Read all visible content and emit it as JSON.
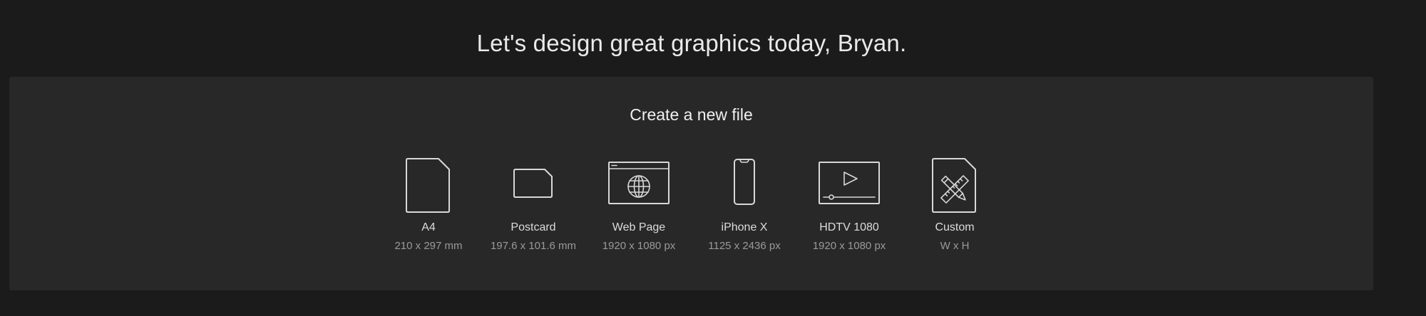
{
  "greeting": "Let's design great graphics today, Bryan.",
  "panel": {
    "title": "Create a new file",
    "presets": [
      {
        "name": "A4",
        "dims": "210 x 297 mm",
        "icon": "document-icon"
      },
      {
        "name": "Postcard",
        "dims": "197.6 x 101.6 mm",
        "icon": "postcard-icon"
      },
      {
        "name": "Web Page",
        "dims": "1920 x 1080 px",
        "icon": "web-page-icon"
      },
      {
        "name": "iPhone X",
        "dims": "1125 x 2436 px",
        "icon": "phone-icon"
      },
      {
        "name": "HDTV 1080",
        "dims": "1920 x 1080 px",
        "icon": "video-screen-icon"
      },
      {
        "name": "Custom",
        "dims": "W x H",
        "icon": "custom-ruler-pencil-icon"
      }
    ]
  },
  "colors": {
    "background": "#1b1b1b",
    "panel": "#282828",
    "text_primary": "#eaeaea",
    "text_secondary": "#9a9a9a",
    "icon_stroke": "#d8d8d8"
  }
}
